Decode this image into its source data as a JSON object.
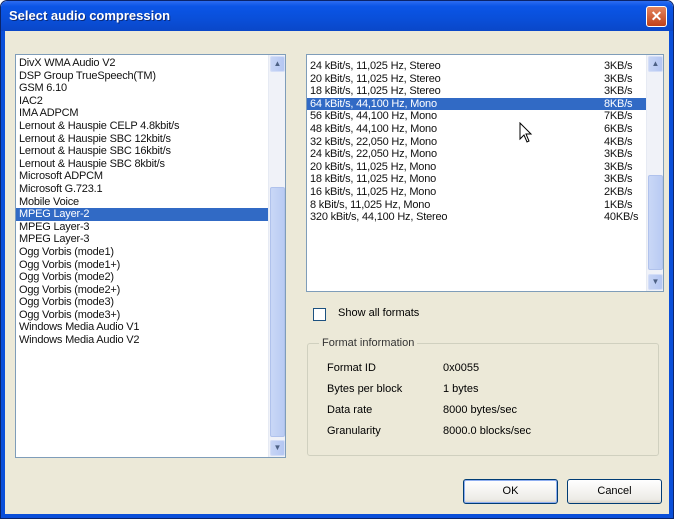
{
  "window": {
    "title": "Select audio compression",
    "close_glyph": "✕"
  },
  "codecs": [
    "DivX WMA Audio V2",
    "DSP Group TrueSpeech(TM)",
    "GSM 6.10",
    "IAC2",
    "IMA ADPCM",
    "Lernout & Hauspie CELP 4.8kbit/s",
    "Lernout & Hauspie SBC 12kbit/s",
    "Lernout & Hauspie SBC 16kbit/s",
    "Lernout & Hauspie SBC 8kbit/s",
    "Microsoft ADPCM",
    "Microsoft G.723.1",
    "Mobile Voice",
    "MPEG Layer-2",
    "MPEG Layer-3",
    "MPEG Layer-3",
    "Ogg Vorbis (mode1)",
    "Ogg Vorbis (mode1+)",
    "Ogg Vorbis (mode2)",
    "Ogg Vorbis (mode2+)",
    "Ogg Vorbis (mode3)",
    "Ogg Vorbis (mode3+)",
    "Windows Media Audio V1",
    "Windows Media Audio V2"
  ],
  "selected_codec_index": 12,
  "formats": [
    {
      "format": "24 kBit/s, 11,025 Hz, Stereo",
      "rate": "3KB/s"
    },
    {
      "format": "20 kBit/s, 11,025 Hz, Stereo",
      "rate": "3KB/s"
    },
    {
      "format": "18 kBit/s, 11,025 Hz, Stereo",
      "rate": "3KB/s"
    },
    {
      "format": "64 kBit/s, 44,100 Hz, Mono",
      "rate": "8KB/s"
    },
    {
      "format": "56 kBit/s, 44,100 Hz, Mono",
      "rate": "7KB/s"
    },
    {
      "format": "48 kBit/s, 44,100 Hz, Mono",
      "rate": "6KB/s"
    },
    {
      "format": "32 kBit/s, 22,050 Hz, Mono",
      "rate": "4KB/s"
    },
    {
      "format": "24 kBit/s, 22,050 Hz, Mono",
      "rate": "3KB/s"
    },
    {
      "format": "20 kBit/s, 11,025 Hz, Mono",
      "rate": "3KB/s"
    },
    {
      "format": "18 kBit/s, 11,025 Hz, Mono",
      "rate": "3KB/s"
    },
    {
      "format": "16 kBit/s, 11,025 Hz, Mono",
      "rate": "2KB/s"
    },
    {
      "format": "8 kBit/s, 11,025 Hz, Mono",
      "rate": "1KB/s"
    },
    {
      "format": "320 kBit/s, 44,100 Hz, Stereo",
      "rate": "40KB/s"
    }
  ],
  "selected_format_index": 3,
  "show_all_formats": {
    "label": "Show all formats",
    "checked": false
  },
  "format_information": {
    "title": "Format information",
    "rows": [
      {
        "label": "Format ID",
        "value": "0x0055"
      },
      {
        "label": "Bytes per block",
        "value": "1 bytes"
      },
      {
        "label": "Data rate",
        "value": "8000 bytes/sec"
      },
      {
        "label": "Granularity",
        "value": "8000.0 blocks/sec"
      }
    ]
  },
  "buttons": {
    "ok": "OK",
    "cancel": "Cancel"
  },
  "scroll_glyphs": {
    "up": "▲",
    "down": "▼"
  },
  "colors": {
    "titlebar": "#0a4fd9",
    "selection": "#316ac5",
    "dialog_face": "#ece9d8",
    "list_border": "#7f9db9"
  },
  "icons": {
    "close": "close-icon",
    "pointer": "mouse-pointer-icon"
  }
}
